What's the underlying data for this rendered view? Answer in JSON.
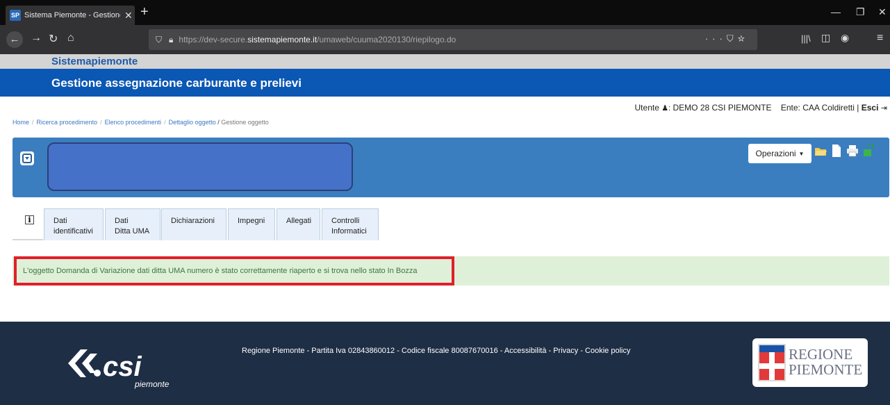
{
  "browser": {
    "tab_favicon": "SP",
    "tab_title": "Sistema Piemonte - Gestione a",
    "url_prefix": "https://dev-secure.",
    "url_domain": "sistemapiemonte.it",
    "url_path": "/umaweb/cuuma2020130/riepilogo.do",
    "url_more": "···"
  },
  "site": {
    "brand": "Sistemapiemonte",
    "app_title": "Gestione assegnazione carburante e prelievi"
  },
  "user": {
    "label": "Utente",
    "name": "DEMO 28 CSI PIEMONTE",
    "ente_label": "Ente:",
    "ente": "CAA Coldiretti",
    "separator": "|",
    "logout": "Esci"
  },
  "breadcrumb": {
    "items": [
      "Home",
      "Ricerca procedimento",
      "Elenco procedimenti",
      "Dettaglio oggetto"
    ],
    "current": "Gestione oggetto"
  },
  "panel": {
    "operations_label": "Operazioni"
  },
  "tabs": [
    {
      "line1": "Dati",
      "line2": "identificativi"
    },
    {
      "line1": "Dati",
      "line2": "Ditta UMA"
    },
    {
      "line1": "Dichiarazioni",
      "line2": ""
    },
    {
      "line1": "Impegni",
      "line2": ""
    },
    {
      "line1": "Allegati",
      "line2": ""
    },
    {
      "line1": "Controlli",
      "line2": "Informatici"
    }
  ],
  "alert": {
    "message": "L'oggetto Domanda di Variazione dati ditta UMA numero è stato correttamente riaperto e si trova nello stato In Bozza"
  },
  "footer": {
    "text": "Regione Piemonte - Partita Iva 02843860012 - Codice fiscale 80087670016 - Accessibilità - Privacy - Cookie policy",
    "csi_logo": "csi",
    "csi_sub": "piemonte",
    "regione_line1": "REGIONE",
    "regione_line2": "PIEMONTE"
  },
  "colors": {
    "brand_blue": "#0b57b4",
    "panel_blue": "#3a7ec0",
    "alert_bg": "#dff0d8",
    "alert_border": "#e0202a",
    "footer_bg": "#1e2e45"
  }
}
